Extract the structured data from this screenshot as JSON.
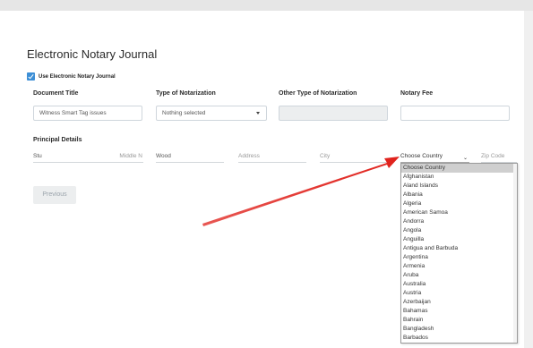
{
  "page": {
    "title": "Electronic Notary Journal",
    "use_journal_label": "Use Electronic Notary Journal",
    "use_journal_checked": true
  },
  "columns": {
    "document_title": "Document Title",
    "type_of_notarization": "Type of Notarization",
    "other_type": "Other Type of Notarization",
    "notary_fee": "Notary Fee"
  },
  "fields": {
    "document_title_value": "Witness Smart Tag issues",
    "type_select_value": "Nothing selected",
    "other_type_value": "",
    "notary_fee_value": ""
  },
  "principal": {
    "section_label": "Principal Details",
    "first_name": "Stu",
    "middle_placeholder": "Middle N",
    "last_name": "Wood",
    "address_placeholder": "Address",
    "city_placeholder": "City",
    "country_selected": "Choose Country",
    "zip_placeholder": "Zip Code"
  },
  "country_options": [
    "Choose Country",
    "Afghanistan",
    "Aland Islands",
    "Albania",
    "Algeria",
    "American Samoa",
    "Andorra",
    "Angola",
    "Anguilla",
    "Antigua and Barbuda",
    "Argentina",
    "Armenia",
    "Aruba",
    "Australia",
    "Austria",
    "Azerbaijan",
    "Bahamas",
    "Bahrain",
    "Bangladesh",
    "Barbados"
  ],
  "buttons": {
    "previous": "Previous"
  },
  "colors": {
    "accent": "#3d8fd6",
    "annotation_arrow": "#e0201a",
    "dropdown_selected_bg": "#cfcfcf"
  }
}
